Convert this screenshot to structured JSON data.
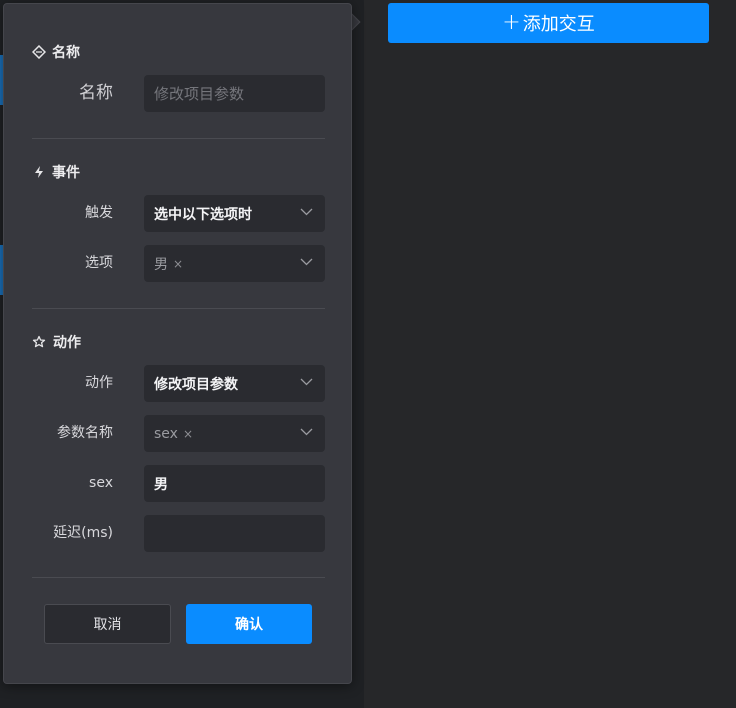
{
  "add_interaction": {
    "plus": "+",
    "label": "添加交互"
  },
  "sections": {
    "name": {
      "title": "名称"
    },
    "event": {
      "title": "事件"
    },
    "action": {
      "title": "动作"
    }
  },
  "fields": {
    "name": {
      "label": "名称",
      "placeholder": "修改项目参数"
    },
    "trigger": {
      "label": "触发",
      "value": "选中以下选项时"
    },
    "option": {
      "label": "选项",
      "tag": "男",
      "tag_remove": "×"
    },
    "action": {
      "label": "动作",
      "value": "修改项目参数"
    },
    "param_name": {
      "label": "参数名称",
      "tag": "sex",
      "tag_remove": "×"
    },
    "sex": {
      "label": "sex",
      "value": "男"
    },
    "delay": {
      "label": "延迟(ms)",
      "value": ""
    }
  },
  "buttons": {
    "cancel": "取消",
    "confirm": "确认"
  },
  "colors": {
    "accent": "#0a8cff",
    "panel": "#37383e",
    "field": "#2a2b30"
  }
}
